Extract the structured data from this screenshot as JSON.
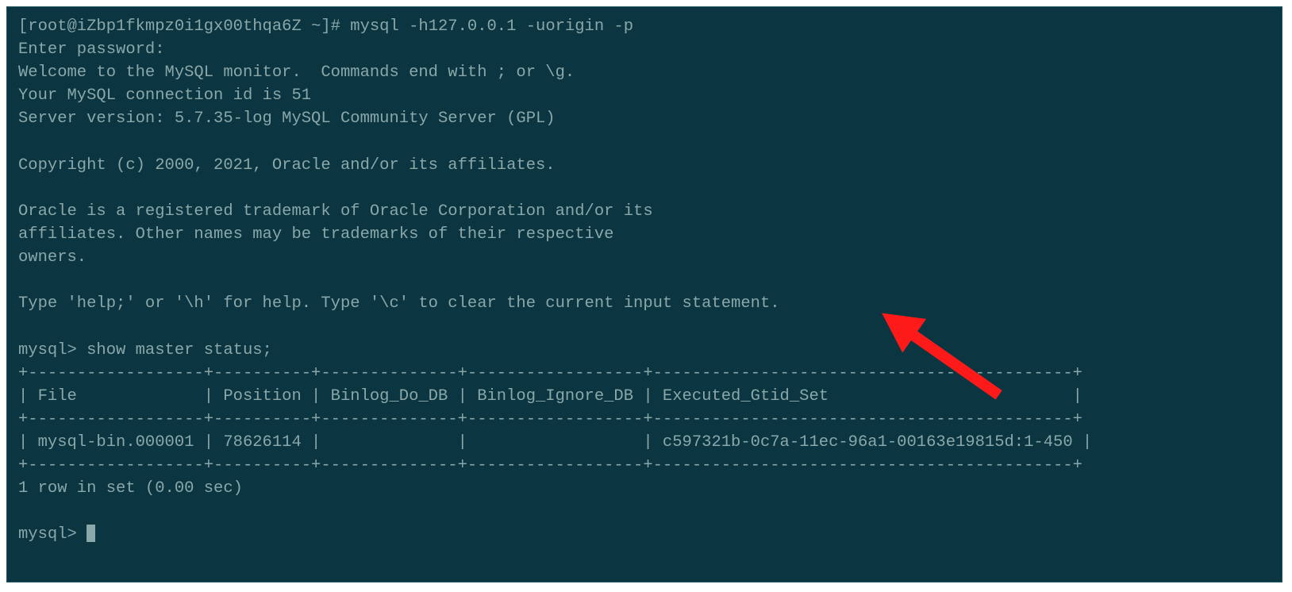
{
  "shell": {
    "prompt": "[root@iZbp1fkmpz0i1gx00thqa6Z ~]# ",
    "command": "mysql -h127.0.0.1 -uorigin -p",
    "password_prompt": "Enter password:",
    "welcome_line1": "Welcome to the MySQL monitor.  Commands end with ; or \\g.",
    "welcome_line2": "Your MySQL connection id is 51",
    "welcome_line3": "Server version: 5.7.35-log MySQL Community Server (GPL)",
    "copyright": "Copyright (c) 2000, 2021, Oracle and/or its affiliates.",
    "trademark_line1": "Oracle is a registered trademark of Oracle Corporation and/or its",
    "trademark_line2": "affiliates. Other names may be trademarks of their respective",
    "trademark_line3": "owners.",
    "help_line": "Type 'help;' or '\\h' for help. Type '\\c' to clear the current input statement."
  },
  "mysql": {
    "prompt": "mysql> ",
    "query": "show master status;",
    "table_sep1": "+------------------+----------+--------------+------------------+-------------------------------------------+",
    "table_header": "| File             | Position | Binlog_Do_DB | Binlog_Ignore_DB | Executed_Gtid_Set                         |",
    "table_sep2": "+------------------+----------+--------------+------------------+-------------------------------------------+",
    "table_row": "| mysql-bin.000001 | 78626114 |              |                  | c597321b-0c7a-11ec-96a1-00163e19815d:1-450 |",
    "table_sep3": "+------------------+----------+--------------+------------------+-------------------------------------------+",
    "result_summary": "1 row in set (0.00 sec)"
  }
}
